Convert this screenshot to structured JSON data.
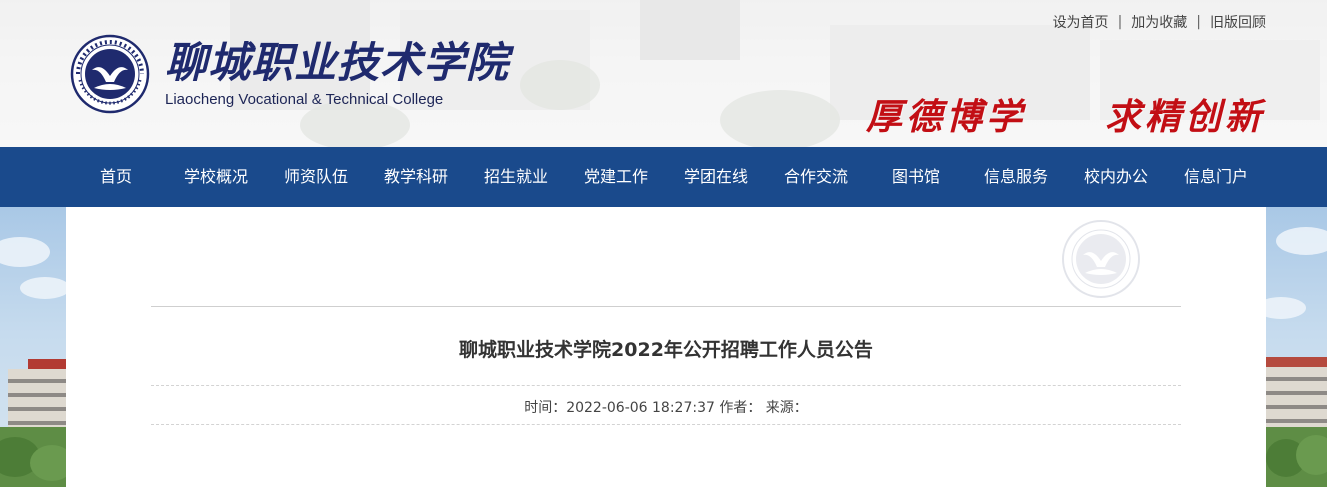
{
  "header": {
    "top_links": [
      "设为首页",
      "加为收藏",
      "旧版回顾"
    ],
    "link_separator": "|",
    "school_name_cn": "聊城职业技术学院",
    "school_name_en": "Liaocheng Vocational & Technical College",
    "motto_part1": "厚德博学",
    "motto_part2": "求精创新",
    "motto_color": "#c20e14",
    "brand_color": "#1f2a6e"
  },
  "nav": {
    "background": "#1a4a8c",
    "items": [
      "首页",
      "学校概况",
      "师资队伍",
      "教学科研",
      "招生就业",
      "党建工作",
      "学团在线",
      "合作交流",
      "图书馆",
      "信息服务",
      "校内办公",
      "信息门户"
    ]
  },
  "article": {
    "title": "聊城职业技术学院2022年公开招聘工作人员公告",
    "meta": "时间：2022-06-06 18:27:37 作者： 来源："
  }
}
